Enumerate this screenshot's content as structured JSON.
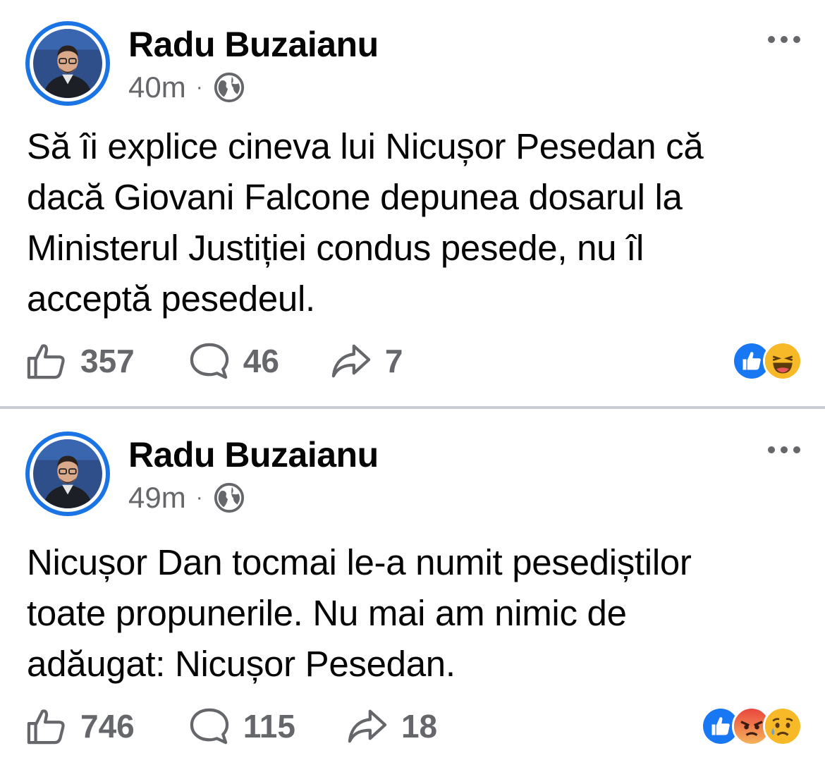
{
  "posts": [
    {
      "author": "Radu Buzaianu",
      "time": "40m",
      "separator": "·",
      "privacy_icon": "globe-icon",
      "text": "Să îi explice cineva lui Nicușor Pesedan că\ndacă Giovani Falcone depunea dosarul la\nMinisterul Justiției condus pesede, nu îl\nacceptă pesedeul.",
      "likes": "357",
      "comments": "46",
      "shares": "7",
      "reactions": [
        "like",
        "haha"
      ]
    },
    {
      "author": "Radu Buzaianu",
      "time": "49m",
      "separator": "·",
      "privacy_icon": "globe-icon",
      "text": "Nicușor Dan tocmai le-a numit pesediștilor\ntoate propunerile. Nu mai am nimic de\nadăugat: Nicușor Pesedan.",
      "likes": "746",
      "comments": "115",
      "shares": "18",
      "reactions": [
        "like",
        "angry",
        "sad"
      ]
    }
  ],
  "colors": {
    "brand": "#1b74e4",
    "text": "#050505",
    "secondary": "#65676b",
    "divider": "#c9ccd1"
  }
}
